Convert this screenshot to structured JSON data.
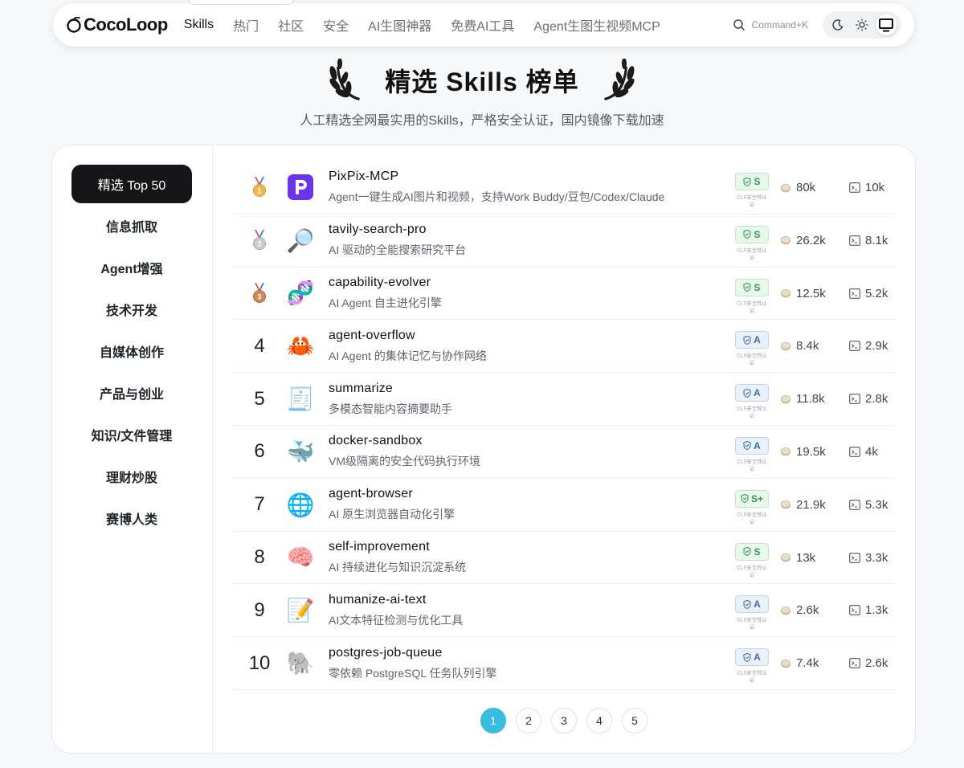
{
  "header": {
    "brand": "CocoLoop",
    "nav": [
      {
        "label": "Skills",
        "active": true
      },
      {
        "label": "热门",
        "active": false
      },
      {
        "label": "社区",
        "active": false
      },
      {
        "label": "安全",
        "active": false
      },
      {
        "label": "AI生图神器",
        "active": false
      },
      {
        "label": "免费AI工具",
        "active": false
      },
      {
        "label": "Agent生图生视频MCP",
        "active": false
      }
    ],
    "search_shortcut": "Command+K",
    "theme_modes": [
      "dark",
      "light",
      "system"
    ],
    "theme_active": "system"
  },
  "hero": {
    "title": "精选 Skills 榜单",
    "subtitle": "人工精选全网最实用的Skills，严格安全认证，国内镜像下载加速"
  },
  "sidebar": {
    "categories": [
      {
        "label": "精选 Top 50",
        "active": true
      },
      {
        "label": "信息抓取",
        "active": false
      },
      {
        "label": "Agent增强",
        "active": false
      },
      {
        "label": "技术开发",
        "active": false
      },
      {
        "label": "自媒体创作",
        "active": false
      },
      {
        "label": "产品与创业",
        "active": false
      },
      {
        "label": "知识/文件管理",
        "active": false
      },
      {
        "label": "理财炒股",
        "active": false
      },
      {
        "label": "赛博人类",
        "active": false
      }
    ]
  },
  "badge_caption": "CLS安全性认证",
  "skills": [
    {
      "rank": "1",
      "medal": "gold",
      "icon": "pixpix-logo",
      "name": "PixPix-MCP",
      "desc": "Agent一键生成AI图片和视频，支持Work Buddy/豆包/Codex/Claude",
      "grade": "S",
      "grade_type": "s",
      "downloads": "80k",
      "installs": "10k"
    },
    {
      "rank": "2",
      "medal": "silver",
      "icon": "🔎",
      "name": "tavily-search-pro",
      "desc": "AI 驱动的全能搜索研究平台",
      "grade": "S",
      "grade_type": "s",
      "downloads": "26.2k",
      "installs": "8.1k"
    },
    {
      "rank": "3",
      "medal": "bronze",
      "icon": "🧬",
      "name": "capability-evolver",
      "desc": "AI Agent 自主进化引擎",
      "grade": "S",
      "grade_type": "s",
      "downloads": "12.5k",
      "installs": "5.2k"
    },
    {
      "rank": "4",
      "medal": "",
      "icon": "🦀",
      "name": "agent-overflow",
      "desc": "AI Agent 的集体记忆与协作网络",
      "grade": "A",
      "grade_type": "a",
      "downloads": "8.4k",
      "installs": "2.9k"
    },
    {
      "rank": "5",
      "medal": "",
      "icon": "🧾",
      "name": "summarize",
      "desc": "多模态智能内容摘要助手",
      "grade": "A",
      "grade_type": "a",
      "downloads": "11.8k",
      "installs": "2.8k"
    },
    {
      "rank": "6",
      "medal": "",
      "icon": "🐳",
      "name": "docker-sandbox",
      "desc": "VM级隔离的安全代码执行环境",
      "grade": "A",
      "grade_type": "a",
      "downloads": "19.5k",
      "installs": "4k"
    },
    {
      "rank": "7",
      "medal": "",
      "icon": "🌐",
      "name": "agent-browser",
      "desc": "AI 原生浏览器自动化引擎",
      "grade": "S+",
      "grade_type": "s",
      "downloads": "21.9k",
      "installs": "5.3k"
    },
    {
      "rank": "8",
      "medal": "",
      "icon": "🧠",
      "name": "self-improvement",
      "desc": "AI 持续进化与知识沉淀系统",
      "grade": "S",
      "grade_type": "s",
      "downloads": "13k",
      "installs": "3.3k"
    },
    {
      "rank": "9",
      "medal": "",
      "icon": "📝",
      "name": "humanize-ai-text",
      "desc": "AI文本特征检测与优化工具",
      "grade": "A",
      "grade_type": "a",
      "downloads": "2.6k",
      "installs": "1.3k"
    },
    {
      "rank": "10",
      "medal": "",
      "icon": "🐘",
      "name": "postgres-job-queue",
      "desc": "零依赖 PostgreSQL 任务队列引擎",
      "grade": "A",
      "grade_type": "a",
      "downloads": "7.4k",
      "installs": "2.6k"
    }
  ],
  "pagination": {
    "pages": [
      "1",
      "2",
      "3",
      "4",
      "5"
    ],
    "current": "1"
  },
  "colors": {
    "accent": "#38bde0",
    "dark": "#161618",
    "grade_s": "#2f9e4a",
    "grade_a": "#3b6fb8"
  }
}
